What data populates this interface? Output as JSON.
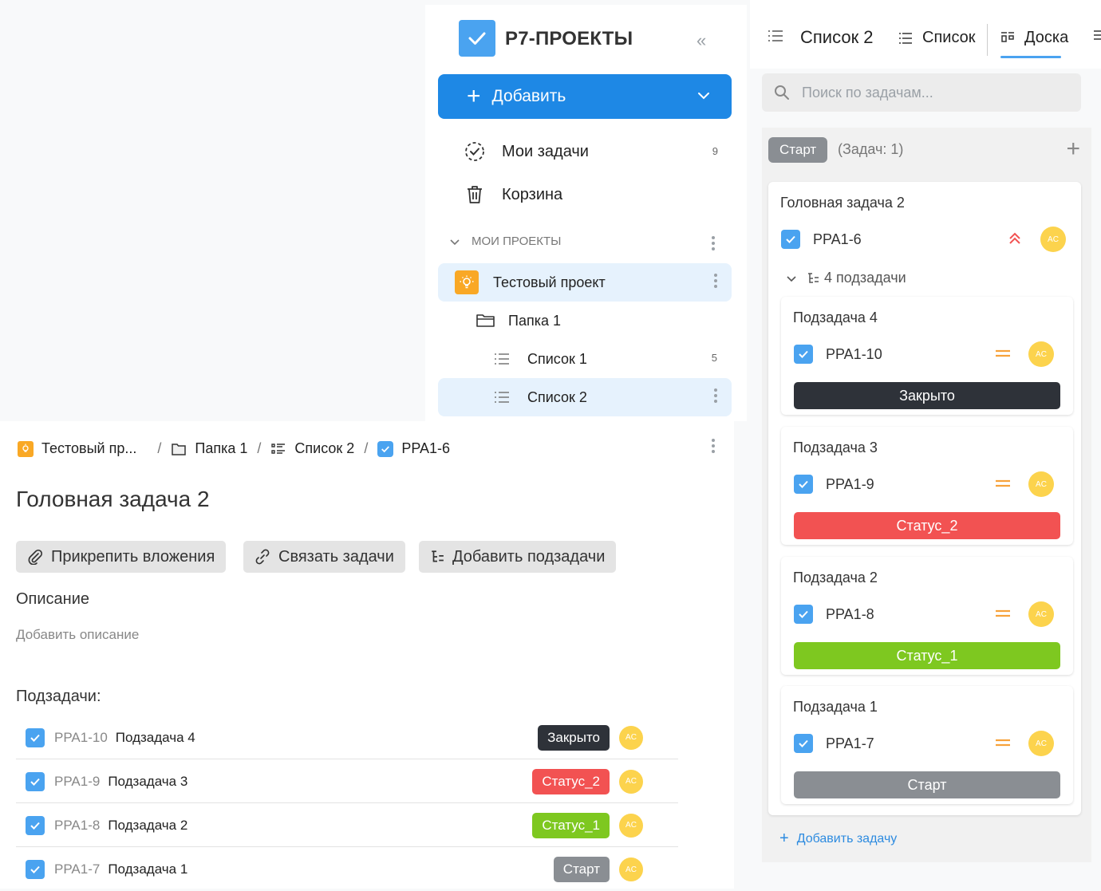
{
  "app": {
    "logo_text": "Р7-ПРОЕКТЫ",
    "collapse_glyph": "«"
  },
  "sidebar": {
    "add_label": "Добавить",
    "my_tasks_label": "Мои задачи",
    "my_tasks_count": "9",
    "trash_label": "Корзина",
    "section_title": "МОИ ПРОЕКТЫ",
    "project_name": "Тестовый проект",
    "folder_name": "Папка 1",
    "list1_name": "Список 1",
    "list1_count": "5",
    "list2_name": "Список 2"
  },
  "header": {
    "list_title": "Список 2",
    "view_list_label": "Список",
    "view_board_label": "Доска"
  },
  "search": {
    "placeholder": "Поиск по задачам..."
  },
  "board": {
    "column_name": "Старт",
    "column_count": "(Задач: 1)",
    "add_task_label": "Добавить задачу",
    "parent": {
      "title": "Головная задача 2",
      "code": "PPA1-6",
      "subtasks_label": "4 подзадачи",
      "avatar": "AC"
    },
    "subtasks": [
      {
        "title": "Подзадача 4",
        "code": "PPA1-10",
        "status": "Закрыто",
        "color": "#2e3239",
        "avatar": "AC"
      },
      {
        "title": "Подзадача 3",
        "code": "PPA1-9",
        "status": "Статус_2",
        "color": "#f25252",
        "avatar": "AC"
      },
      {
        "title": "Подзадача 2",
        "code": "PPA1-8",
        "status": "Статус_1",
        "color": "#7ec820",
        "avatar": "AC"
      },
      {
        "title": "Подзадача 1",
        "code": "PPA1-7",
        "status": "Старт",
        "color": "#8a8e93",
        "avatar": "AC"
      }
    ]
  },
  "details": {
    "breadcrumb": {
      "project": "Тестовый пр...",
      "folder": "Папка 1",
      "list": "Список 2",
      "task": "PPA1-6"
    },
    "title": "Головная задача 2",
    "attach_label": "Прикрепить вложения",
    "link_label": "Связать задачи",
    "add_subtasks_label": "Добавить подзадачи",
    "description_label": "Описание",
    "add_description": "Добавить описание",
    "subtasks_label": "Подзадачи:",
    "subtasks": [
      {
        "code": "PPA1-10",
        "name": "Подзадача 4",
        "status": "Закрыто",
        "color": "#2e3239",
        "avatar": "AC"
      },
      {
        "code": "PPA1-9",
        "name": "Подзадача 3",
        "status": "Статус_2",
        "color": "#f25252",
        "avatar": "AC"
      },
      {
        "code": "PPA1-8",
        "name": "Подзадача 2",
        "status": "Статус_1",
        "color": "#7ec820",
        "avatar": "AC"
      },
      {
        "code": "PPA1-7",
        "name": "Подзадача 1",
        "status": "Старт",
        "color": "#8a8e93",
        "avatar": "AC"
      }
    ]
  },
  "colors": {
    "accent": "#1e88e5",
    "priority_high": "#f25252",
    "priority_medium": "#f7a23b",
    "avatar": "#fcd34d"
  }
}
